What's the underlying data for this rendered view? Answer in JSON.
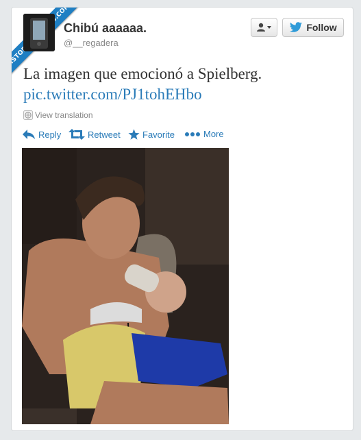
{
  "watermark": {
    "text": "VISTOENLASREDES.COM"
  },
  "author": {
    "name": "Chibú aaaaaa.",
    "handle": "@__regadera"
  },
  "header": {
    "user_button_icon": "user-dropdown-icon",
    "follow_label": "Follow"
  },
  "tweet": {
    "text": "La imagen que emocionó a Spielberg.",
    "link": "pic.twitter.com/PJ1tohEHbo",
    "translation_label": "View translation"
  },
  "actions": [
    {
      "label": "Reply",
      "icon": "reply-icon"
    },
    {
      "label": "Retweet",
      "icon": "retweet-icon"
    },
    {
      "label": "Favorite",
      "icon": "star-icon"
    },
    {
      "label": "More",
      "icon": "more-icon"
    }
  ],
  "colors": {
    "link": "#2a7bb8",
    "follow_bird": "#2f9bd8",
    "watermark": "#1f7fc3"
  }
}
